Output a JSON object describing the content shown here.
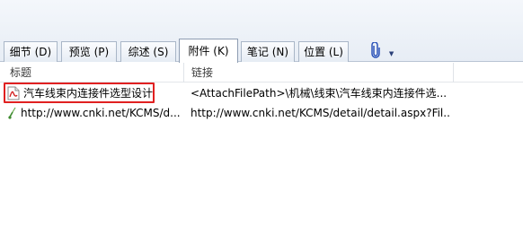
{
  "tabs": [
    {
      "label": "细节 (D)",
      "active": false
    },
    {
      "label": "预览 (P)",
      "active": false
    },
    {
      "label": "综述 (S)",
      "active": false
    },
    {
      "label": "附件 (K)",
      "active": true
    },
    {
      "label": "笔记 (N)",
      "active": false
    },
    {
      "label": "位置 (L)",
      "active": false
    }
  ],
  "attach_menu": {
    "icon": "paperclip-icon",
    "arrow": "▼"
  },
  "columns": {
    "title": "标题",
    "link": "链接"
  },
  "rows": [
    {
      "icon": "pdf-icon",
      "title": "汽车线束内连接件选型设计",
      "link": "<AttachFilePath>\\机械\\线束\\汽车线束内连接件选...",
      "selected": true
    },
    {
      "icon": "web-link-icon",
      "title": "http://www.cnki.net/KCMS/d...",
      "link": "http://www.cnki.net/KCMS/detail/detail.aspx?Fil..."
    }
  ],
  "colors": {
    "highlight": "#e02020",
    "tab_text": "#000000",
    "accent": "#2a3f78"
  }
}
